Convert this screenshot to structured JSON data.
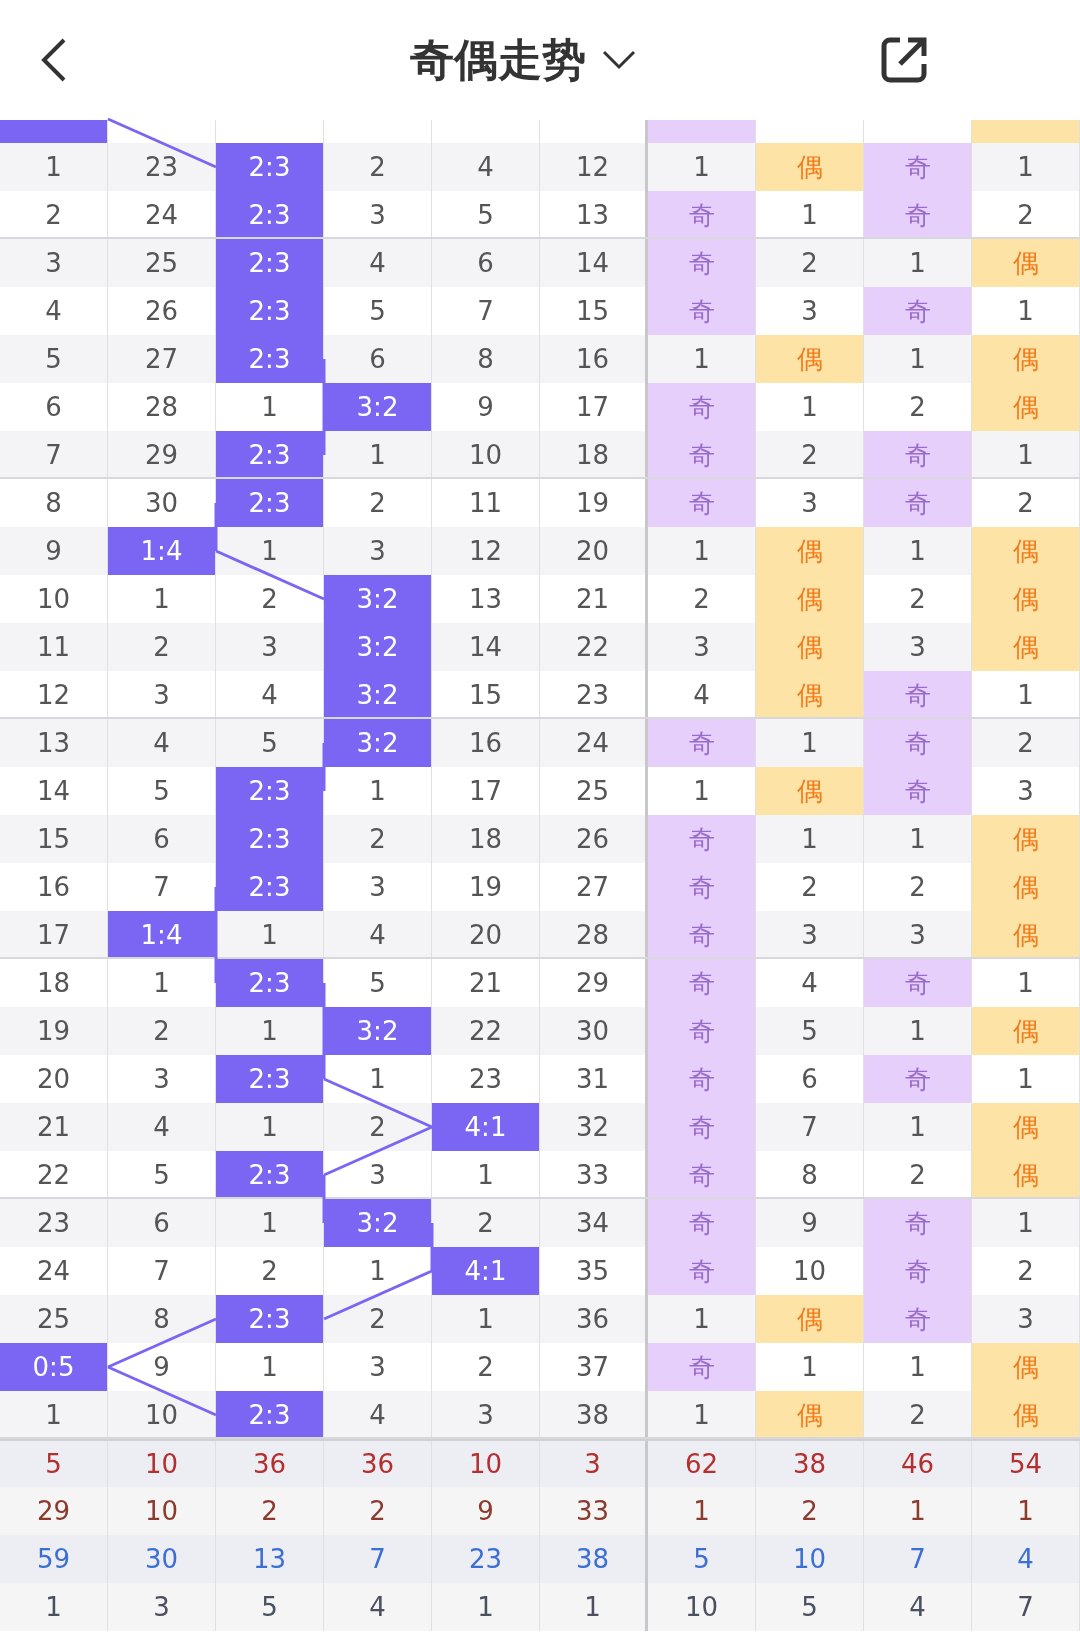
{
  "header": {
    "title": "奇偶走势"
  },
  "columns": [
    {
      "kind": "ratio"
    },
    {
      "kind": "ratio"
    },
    {
      "kind": "ratio"
    },
    {
      "kind": "ratio"
    },
    {
      "kind": "ratio"
    },
    {
      "kind": "ratio"
    },
    {
      "kind": "odd"
    },
    {
      "kind": "even"
    },
    {
      "kind": "odd"
    },
    {
      "kind": "even"
    }
  ],
  "rows": [
    {
      "cells": [
        {
          "hit": true
        },
        {
          "hit": false
        },
        {
          "hit": false
        },
        {
          "hit": false
        },
        {
          "hit": false
        },
        {
          "hit": false
        },
        {
          "hit": true
        },
        {
          "hit": false
        },
        {
          "hit": false
        },
        {
          "hit": true
        }
      ]
    },
    {
      "cells": [
        {
          "text": "1",
          "hit": false
        },
        {
          "text": "23",
          "hit": false
        },
        {
          "text": "2:3",
          "hit": true
        },
        {
          "text": "2",
          "hit": false
        },
        {
          "text": "4",
          "hit": false
        },
        {
          "text": "12",
          "hit": false
        },
        {
          "text": "1",
          "hit": false
        },
        {
          "text": "偶",
          "hit": true
        },
        {
          "text": "奇",
          "hit": true
        },
        {
          "text": "1",
          "hit": false
        }
      ]
    },
    {
      "cells": [
        {
          "text": "2",
          "hit": false
        },
        {
          "text": "24",
          "hit": false
        },
        {
          "text": "2:3",
          "hit": true
        },
        {
          "text": "3",
          "hit": false
        },
        {
          "text": "5",
          "hit": false
        },
        {
          "text": "13",
          "hit": false
        },
        {
          "text": "奇",
          "hit": true
        },
        {
          "text": "1",
          "hit": false
        },
        {
          "text": "奇",
          "hit": true
        },
        {
          "text": "2",
          "hit": false
        }
      ]
    },
    {
      "cells": [
        {
          "text": "3",
          "hit": false
        },
        {
          "text": "25",
          "hit": false
        },
        {
          "text": "2:3",
          "hit": true
        },
        {
          "text": "4",
          "hit": false
        },
        {
          "text": "6",
          "hit": false
        },
        {
          "text": "14",
          "hit": false
        },
        {
          "text": "奇",
          "hit": true
        },
        {
          "text": "2",
          "hit": false
        },
        {
          "text": "1",
          "hit": false
        },
        {
          "text": "偶",
          "hit": true
        }
      ]
    },
    {
      "cells": [
        {
          "text": "4",
          "hit": false
        },
        {
          "text": "26",
          "hit": false
        },
        {
          "text": "2:3",
          "hit": true
        },
        {
          "text": "5",
          "hit": false
        },
        {
          "text": "7",
          "hit": false
        },
        {
          "text": "15",
          "hit": false
        },
        {
          "text": "奇",
          "hit": true
        },
        {
          "text": "3",
          "hit": false
        },
        {
          "text": "奇",
          "hit": true
        },
        {
          "text": "1",
          "hit": false
        }
      ]
    },
    {
      "cells": [
        {
          "text": "5",
          "hit": false
        },
        {
          "text": "27",
          "hit": false
        },
        {
          "text": "2:3",
          "hit": true
        },
        {
          "text": "6",
          "hit": false
        },
        {
          "text": "8",
          "hit": false
        },
        {
          "text": "16",
          "hit": false
        },
        {
          "text": "1",
          "hit": false
        },
        {
          "text": "偶",
          "hit": true
        },
        {
          "text": "1",
          "hit": false
        },
        {
          "text": "偶",
          "hit": true
        }
      ]
    },
    {
      "cells": [
        {
          "text": "6",
          "hit": false
        },
        {
          "text": "28",
          "hit": false
        },
        {
          "text": "1",
          "hit": false
        },
        {
          "text": "3:2",
          "hit": true
        },
        {
          "text": "9",
          "hit": false
        },
        {
          "text": "17",
          "hit": false
        },
        {
          "text": "奇",
          "hit": true
        },
        {
          "text": "1",
          "hit": false
        },
        {
          "text": "2",
          "hit": false
        },
        {
          "text": "偶",
          "hit": true
        }
      ]
    },
    {
      "cells": [
        {
          "text": "7",
          "hit": false
        },
        {
          "text": "29",
          "hit": false
        },
        {
          "text": "2:3",
          "hit": true
        },
        {
          "text": "1",
          "hit": false
        },
        {
          "text": "10",
          "hit": false
        },
        {
          "text": "18",
          "hit": false
        },
        {
          "text": "奇",
          "hit": true
        },
        {
          "text": "2",
          "hit": false
        },
        {
          "text": "奇",
          "hit": true
        },
        {
          "text": "1",
          "hit": false
        }
      ]
    },
    {
      "cells": [
        {
          "text": "8",
          "hit": false
        },
        {
          "text": "30",
          "hit": false
        },
        {
          "text": "2:3",
          "hit": true
        },
        {
          "text": "2",
          "hit": false
        },
        {
          "text": "11",
          "hit": false
        },
        {
          "text": "19",
          "hit": false
        },
        {
          "text": "奇",
          "hit": true
        },
        {
          "text": "3",
          "hit": false
        },
        {
          "text": "奇",
          "hit": true
        },
        {
          "text": "2",
          "hit": false
        }
      ]
    },
    {
      "cells": [
        {
          "text": "9",
          "hit": false
        },
        {
          "text": "1:4",
          "hit": true
        },
        {
          "text": "1",
          "hit": false
        },
        {
          "text": "3",
          "hit": false
        },
        {
          "text": "12",
          "hit": false
        },
        {
          "text": "20",
          "hit": false
        },
        {
          "text": "1",
          "hit": false
        },
        {
          "text": "偶",
          "hit": true
        },
        {
          "text": "1",
          "hit": false
        },
        {
          "text": "偶",
          "hit": true
        }
      ]
    },
    {
      "cells": [
        {
          "text": "10",
          "hit": false
        },
        {
          "text": "1",
          "hit": false
        },
        {
          "text": "2",
          "hit": false
        },
        {
          "text": "3:2",
          "hit": true
        },
        {
          "text": "13",
          "hit": false
        },
        {
          "text": "21",
          "hit": false
        },
        {
          "text": "2",
          "hit": false
        },
        {
          "text": "偶",
          "hit": true
        },
        {
          "text": "2",
          "hit": false
        },
        {
          "text": "偶",
          "hit": true
        }
      ]
    },
    {
      "cells": [
        {
          "text": "11",
          "hit": false
        },
        {
          "text": "2",
          "hit": false
        },
        {
          "text": "3",
          "hit": false
        },
        {
          "text": "3:2",
          "hit": true
        },
        {
          "text": "14",
          "hit": false
        },
        {
          "text": "22",
          "hit": false
        },
        {
          "text": "3",
          "hit": false
        },
        {
          "text": "偶",
          "hit": true
        },
        {
          "text": "3",
          "hit": false
        },
        {
          "text": "偶",
          "hit": true
        }
      ]
    },
    {
      "cells": [
        {
          "text": "12",
          "hit": false
        },
        {
          "text": "3",
          "hit": false
        },
        {
          "text": "4",
          "hit": false
        },
        {
          "text": "3:2",
          "hit": true
        },
        {
          "text": "15",
          "hit": false
        },
        {
          "text": "23",
          "hit": false
        },
        {
          "text": "4",
          "hit": false
        },
        {
          "text": "偶",
          "hit": true
        },
        {
          "text": "奇",
          "hit": true
        },
        {
          "text": "1",
          "hit": false
        }
      ]
    },
    {
      "cells": [
        {
          "text": "13",
          "hit": false
        },
        {
          "text": "4",
          "hit": false
        },
        {
          "text": "5",
          "hit": false
        },
        {
          "text": "3:2",
          "hit": true
        },
        {
          "text": "16",
          "hit": false
        },
        {
          "text": "24",
          "hit": false
        },
        {
          "text": "奇",
          "hit": true
        },
        {
          "text": "1",
          "hit": false
        },
        {
          "text": "奇",
          "hit": true
        },
        {
          "text": "2",
          "hit": false
        }
      ]
    },
    {
      "cells": [
        {
          "text": "14",
          "hit": false
        },
        {
          "text": "5",
          "hit": false
        },
        {
          "text": "2:3",
          "hit": true
        },
        {
          "text": "1",
          "hit": false
        },
        {
          "text": "17",
          "hit": false
        },
        {
          "text": "25",
          "hit": false
        },
        {
          "text": "1",
          "hit": false
        },
        {
          "text": "偶",
          "hit": true
        },
        {
          "text": "奇",
          "hit": true
        },
        {
          "text": "3",
          "hit": false
        }
      ]
    },
    {
      "cells": [
        {
          "text": "15",
          "hit": false
        },
        {
          "text": "6",
          "hit": false
        },
        {
          "text": "2:3",
          "hit": true
        },
        {
          "text": "2",
          "hit": false
        },
        {
          "text": "18",
          "hit": false
        },
        {
          "text": "26",
          "hit": false
        },
        {
          "text": "奇",
          "hit": true
        },
        {
          "text": "1",
          "hit": false
        },
        {
          "text": "1",
          "hit": false
        },
        {
          "text": "偶",
          "hit": true
        }
      ]
    },
    {
      "cells": [
        {
          "text": "16",
          "hit": false
        },
        {
          "text": "7",
          "hit": false
        },
        {
          "text": "2:3",
          "hit": true
        },
        {
          "text": "3",
          "hit": false
        },
        {
          "text": "19",
          "hit": false
        },
        {
          "text": "27",
          "hit": false
        },
        {
          "text": "奇",
          "hit": true
        },
        {
          "text": "2",
          "hit": false
        },
        {
          "text": "2",
          "hit": false
        },
        {
          "text": "偶",
          "hit": true
        }
      ]
    },
    {
      "cells": [
        {
          "text": "17",
          "hit": false
        },
        {
          "text": "1:4",
          "hit": true
        },
        {
          "text": "1",
          "hit": false
        },
        {
          "text": "4",
          "hit": false
        },
        {
          "text": "20",
          "hit": false
        },
        {
          "text": "28",
          "hit": false
        },
        {
          "text": "奇",
          "hit": true
        },
        {
          "text": "3",
          "hit": false
        },
        {
          "text": "3",
          "hit": false
        },
        {
          "text": "偶",
          "hit": true
        }
      ]
    },
    {
      "cells": [
        {
          "text": "18",
          "hit": false
        },
        {
          "text": "1",
          "hit": false
        },
        {
          "text": "2:3",
          "hit": true
        },
        {
          "text": "5",
          "hit": false
        },
        {
          "text": "21",
          "hit": false
        },
        {
          "text": "29",
          "hit": false
        },
        {
          "text": "奇",
          "hit": true
        },
        {
          "text": "4",
          "hit": false
        },
        {
          "text": "奇",
          "hit": true
        },
        {
          "text": "1",
          "hit": false
        }
      ]
    },
    {
      "cells": [
        {
          "text": "19",
          "hit": false
        },
        {
          "text": "2",
          "hit": false
        },
        {
          "text": "1",
          "hit": false
        },
        {
          "text": "3:2",
          "hit": true
        },
        {
          "text": "22",
          "hit": false
        },
        {
          "text": "30",
          "hit": false
        },
        {
          "text": "奇",
          "hit": true
        },
        {
          "text": "5",
          "hit": false
        },
        {
          "text": "1",
          "hit": false
        },
        {
          "text": "偶",
          "hit": true
        }
      ]
    },
    {
      "cells": [
        {
          "text": "20",
          "hit": false
        },
        {
          "text": "3",
          "hit": false
        },
        {
          "text": "2:3",
          "hit": true
        },
        {
          "text": "1",
          "hit": false
        },
        {
          "text": "23",
          "hit": false
        },
        {
          "text": "31",
          "hit": false
        },
        {
          "text": "奇",
          "hit": true
        },
        {
          "text": "6",
          "hit": false
        },
        {
          "text": "奇",
          "hit": true
        },
        {
          "text": "1",
          "hit": false
        }
      ]
    },
    {
      "cells": [
        {
          "text": "21",
          "hit": false
        },
        {
          "text": "4",
          "hit": false
        },
        {
          "text": "1",
          "hit": false
        },
        {
          "text": "2",
          "hit": false
        },
        {
          "text": "4:1",
          "hit": true
        },
        {
          "text": "32",
          "hit": false
        },
        {
          "text": "奇",
          "hit": true
        },
        {
          "text": "7",
          "hit": false
        },
        {
          "text": "1",
          "hit": false
        },
        {
          "text": "偶",
          "hit": true
        }
      ]
    },
    {
      "cells": [
        {
          "text": "22",
          "hit": false
        },
        {
          "text": "5",
          "hit": false
        },
        {
          "text": "2:3",
          "hit": true
        },
        {
          "text": "3",
          "hit": false
        },
        {
          "text": "1",
          "hit": false
        },
        {
          "text": "33",
          "hit": false
        },
        {
          "text": "奇",
          "hit": true
        },
        {
          "text": "8",
          "hit": false
        },
        {
          "text": "2",
          "hit": false
        },
        {
          "text": "偶",
          "hit": true
        }
      ]
    },
    {
      "cells": [
        {
          "text": "23",
          "hit": false
        },
        {
          "text": "6",
          "hit": false
        },
        {
          "text": "1",
          "hit": false
        },
        {
          "text": "3:2",
          "hit": true
        },
        {
          "text": "2",
          "hit": false
        },
        {
          "text": "34",
          "hit": false
        },
        {
          "text": "奇",
          "hit": true
        },
        {
          "text": "9",
          "hit": false
        },
        {
          "text": "奇",
          "hit": true
        },
        {
          "text": "1",
          "hit": false
        }
      ]
    },
    {
      "cells": [
        {
          "text": "24",
          "hit": false
        },
        {
          "text": "7",
          "hit": false
        },
        {
          "text": "2",
          "hit": false
        },
        {
          "text": "1",
          "hit": false
        },
        {
          "text": "4:1",
          "hit": true
        },
        {
          "text": "35",
          "hit": false
        },
        {
          "text": "奇",
          "hit": true
        },
        {
          "text": "10",
          "hit": false
        },
        {
          "text": "奇",
          "hit": true
        },
        {
          "text": "2",
          "hit": false
        }
      ]
    },
    {
      "cells": [
        {
          "text": "25",
          "hit": false
        },
        {
          "text": "8",
          "hit": false
        },
        {
          "text": "2:3",
          "hit": true
        },
        {
          "text": "2",
          "hit": false
        },
        {
          "text": "1",
          "hit": false
        },
        {
          "text": "36",
          "hit": false
        },
        {
          "text": "1",
          "hit": false
        },
        {
          "text": "偶",
          "hit": true
        },
        {
          "text": "奇",
          "hit": true
        },
        {
          "text": "3",
          "hit": false
        }
      ]
    },
    {
      "cells": [
        {
          "text": "0:5",
          "hit": true
        },
        {
          "text": "9",
          "hit": false
        },
        {
          "text": "1",
          "hit": false
        },
        {
          "text": "3",
          "hit": false
        },
        {
          "text": "2",
          "hit": false
        },
        {
          "text": "37",
          "hit": false
        },
        {
          "text": "奇",
          "hit": true
        },
        {
          "text": "1",
          "hit": false
        },
        {
          "text": "1",
          "hit": false
        },
        {
          "text": "偶",
          "hit": true
        }
      ]
    },
    {
      "cells": [
        {
          "text": "1",
          "hit": false
        },
        {
          "text": "10",
          "hit": false
        },
        {
          "text": "2:3",
          "hit": true
        },
        {
          "text": "4",
          "hit": false
        },
        {
          "text": "3",
          "hit": false
        },
        {
          "text": "38",
          "hit": false
        },
        {
          "text": "1",
          "hit": false
        },
        {
          "text": "偶",
          "hit": true
        },
        {
          "text": "2",
          "hit": false
        },
        {
          "text": "偶",
          "hit": true
        }
      ]
    }
  ],
  "stats": [
    {
      "color": "#b3302f",
      "values": [
        "5",
        "10",
        "36",
        "36",
        "10",
        "3",
        "62",
        "38",
        "46",
        "54"
      ]
    },
    {
      "color": "#8b3a2e",
      "values": [
        "29",
        "10",
        "2",
        "2",
        "9",
        "33",
        "1",
        "2",
        "1",
        "1"
      ]
    },
    {
      "color": "#3b6fd4",
      "values": [
        "59",
        "30",
        "13",
        "7",
        "23",
        "38",
        "5",
        "10",
        "7",
        "4"
      ]
    },
    {
      "color": "#4a5060",
      "values": [
        "1",
        "3",
        "5",
        "4",
        "1",
        "1",
        "10",
        "5",
        "4",
        "7"
      ]
    }
  ]
}
